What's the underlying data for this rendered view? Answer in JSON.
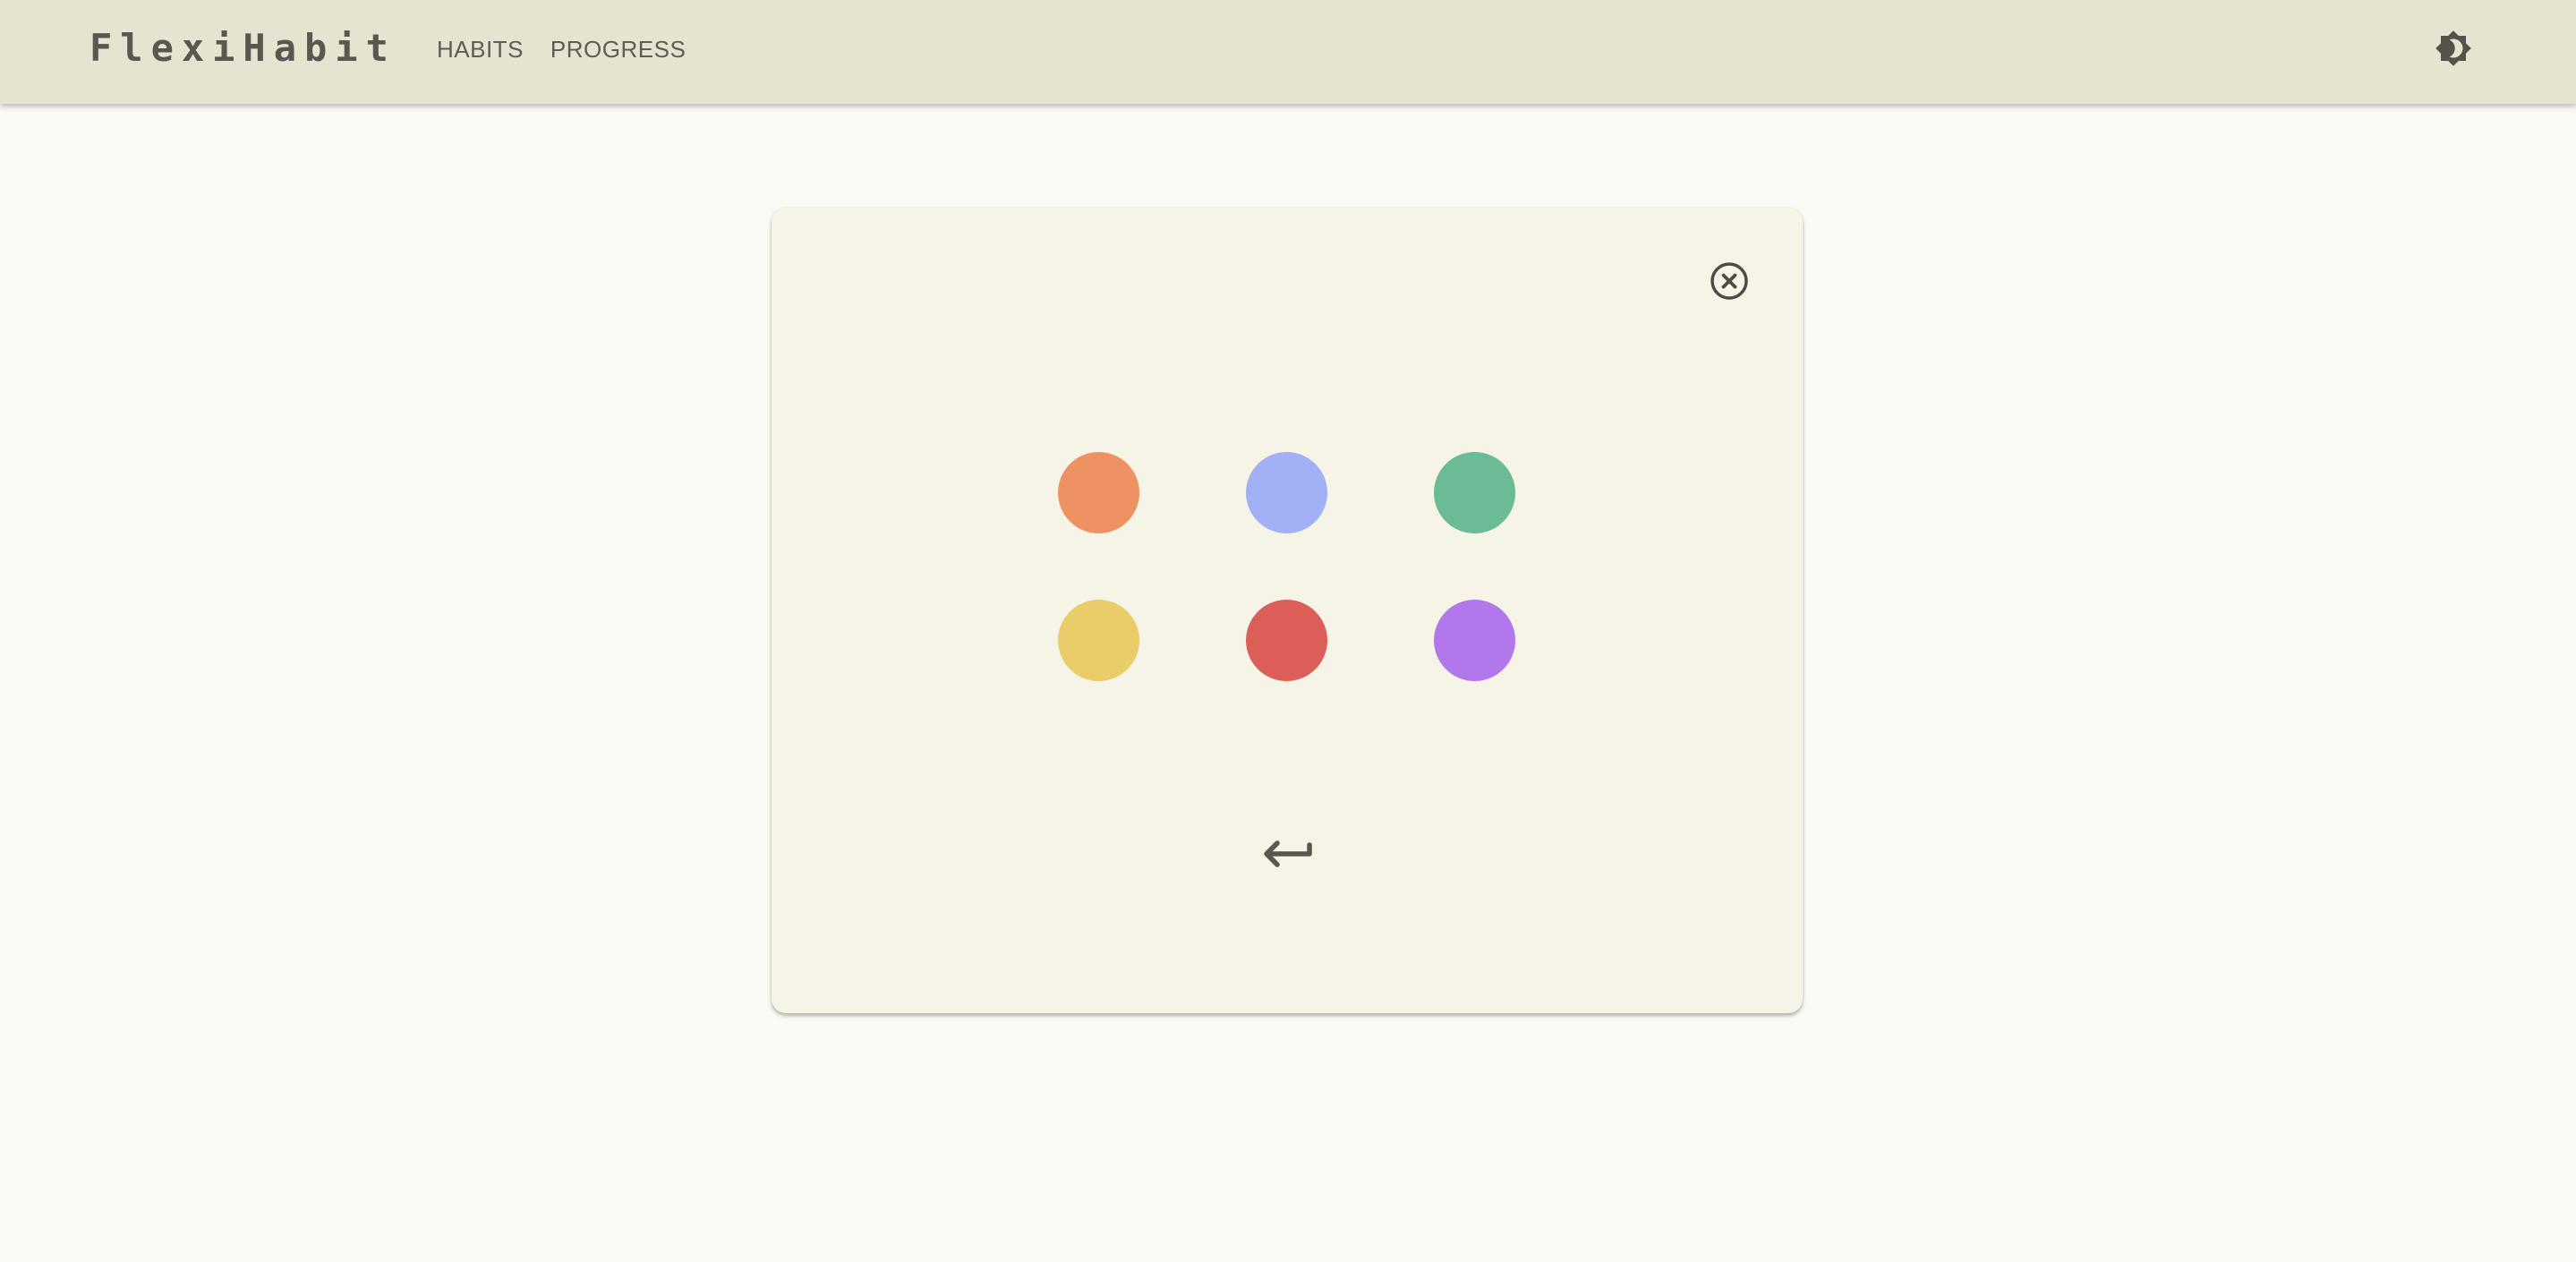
{
  "app": {
    "title": "FlexiHabit"
  },
  "nav": {
    "items": [
      {
        "label": "HABITS"
      },
      {
        "label": "PROGRESS"
      }
    ]
  },
  "header": {
    "theme_icon": "brightness-icon"
  },
  "dialog": {
    "close_icon": "close-circle-icon",
    "back_icon": "return-arrow-icon",
    "colors": [
      {
        "name": "orange",
        "hex": "#ef9263"
      },
      {
        "name": "blue",
        "hex": "#a2b1f6"
      },
      {
        "name": "green",
        "hex": "#6bbb96"
      },
      {
        "name": "yellow",
        "hex": "#e8cd68"
      },
      {
        "name": "red",
        "hex": "#db5f58"
      },
      {
        "name": "purple",
        "hex": "#b277ea"
      }
    ]
  },
  "theme": {
    "header_bg": "#e6e3d0",
    "page_bg": "#faf9f4",
    "dialog_bg": "#f6f3e7",
    "text": "#5a5650"
  }
}
